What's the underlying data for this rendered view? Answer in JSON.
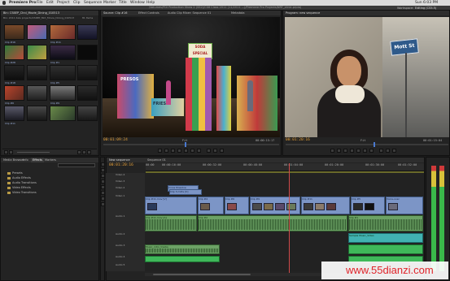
{
  "menubar": {
    "app": "Premiere Pro",
    "items": [
      "File",
      "Edit",
      "Project",
      "Clip",
      "Sequence",
      "Marker",
      "Title",
      "Window",
      "Help"
    ],
    "clock": "Sun 6:03 PM"
  },
  "titlebar": {
    "path": "/Volumes/PDI Production Show 2 (SS2)/CS6 Class 2011 (11/2011 ...)/Premiere Pro Projects/NRT_clinic.prproj"
  },
  "workspace": {
    "label": "Workspace:",
    "value": "Editing (CS5.5)"
  },
  "project_panel": {
    "tab": "Bin: CS6EP_Chnl_Movie_Dining_010513",
    "subtitle": "Bin: 2011 dale projects/CS6EP_Mnt_Movie_Dining_010513",
    "count": "81 Items",
    "clips": [
      "Clip #16",
      "Clip #11",
      "Clip #28",
      "Clip #1",
      "Clip #18",
      "Clip #5",
      "Clip #6",
      "Clip #9",
      "Clip #11"
    ]
  },
  "effects_panel": {
    "tabs": [
      "Media Browser",
      "Info",
      "Effects",
      "Markers"
    ],
    "active_tab": "Effects",
    "folders": [
      "Presets",
      "Audio Effects",
      "Audio Transitions",
      "Video Effects",
      "Video Transitions"
    ]
  },
  "source_monitor": {
    "tabs": [
      "Source: Clip #16",
      "Effect Controls",
      "Audio Clip Mixer: Sequence 01",
      "Metadata"
    ],
    "timecode_in": "00:01:09:24",
    "fit": "Fit",
    "timecode_out": "00:00:15:17",
    "sign_text": "SODA SPECIAL $3.00",
    "booth_text": "PRESOS",
    "booth_text2": "FRIES"
  },
  "program_monitor": {
    "tab": "Program: new sequence",
    "timecode_in": "00:01:20:16",
    "fit": "Fit",
    "timecode_out": "00:01:15:04",
    "street_sign": "Mott St"
  },
  "timeline": {
    "tabs": [
      "New sequence",
      "Sequence 01"
    ],
    "timecode": "00:01:20:16",
    "ruler": [
      "00:00",
      "00:00:16:00",
      "00:00:32:00",
      "00:00:48:00",
      "00:01:04:00",
      "00:01:20:00",
      "00:01:36:00",
      "00:01:52:00",
      "00:02:08:00",
      "00:02:24:00"
    ],
    "tracks": [
      "Video 4",
      "Video 3",
      "Video 2",
      "Video 1",
      "Audio 1",
      "Audio 2",
      "Audio 3",
      "Audio 4",
      "Audio 5"
    ],
    "clips": {
      "v3": "Cross Dissolve",
      "v2": "Clip 3.m2ts [V]",
      "v1_a": "Clip #11.mov [V]",
      "v1_b": "Clip #4",
      "v1_c": "Clip #6",
      "v1_d": "Clip #9",
      "v1_e": "Clip #11",
      "v1_f": "Clip #5",
      "v1_g": "Voice-over",
      "a1": "Clip #11.mov [A]",
      "a2": "Clip #2",
      "a3": "Clip #1",
      "a4": "Sample Music_Video",
      "a5": "Music_intro_tracks"
    }
  },
  "watermark": "www.55dianzi.com"
}
